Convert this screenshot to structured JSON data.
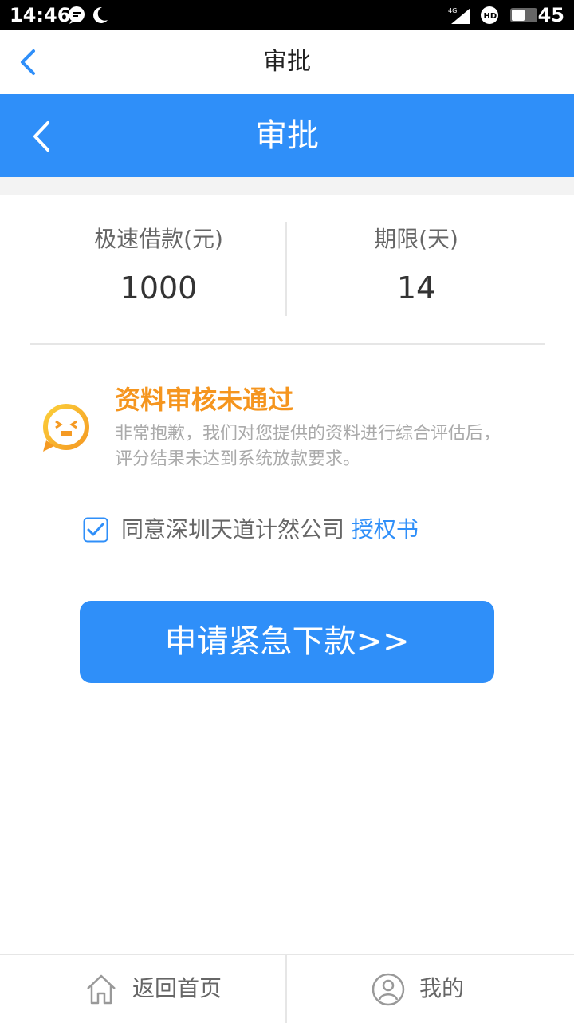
{
  "status_bar": {
    "time": "14:46",
    "network": "4G",
    "battery": "45"
  },
  "header_top": {
    "title": "审批"
  },
  "header_blue": {
    "title": "审批"
  },
  "loan_summary": {
    "amount_label": "极速借款(元)",
    "amount_value": "1000",
    "term_label": "期限(天)",
    "term_value": "14"
  },
  "review_result": {
    "title": "资料审核未通过",
    "line1": "非常抱歉，我们对您提供的资料进行综合评估后，",
    "line2": "评分结果未达到系统放款要求。"
  },
  "agreement": {
    "checked": true,
    "text": "同意深圳天道计然公司",
    "link": "授权书"
  },
  "actions": {
    "apply_label": "申请紧急下款>>"
  },
  "bottom_nav": {
    "home_label": "返回首页",
    "mine_label": "我的"
  },
  "colors": {
    "primary": "#2f8ff9",
    "warning": "#f5951e"
  }
}
